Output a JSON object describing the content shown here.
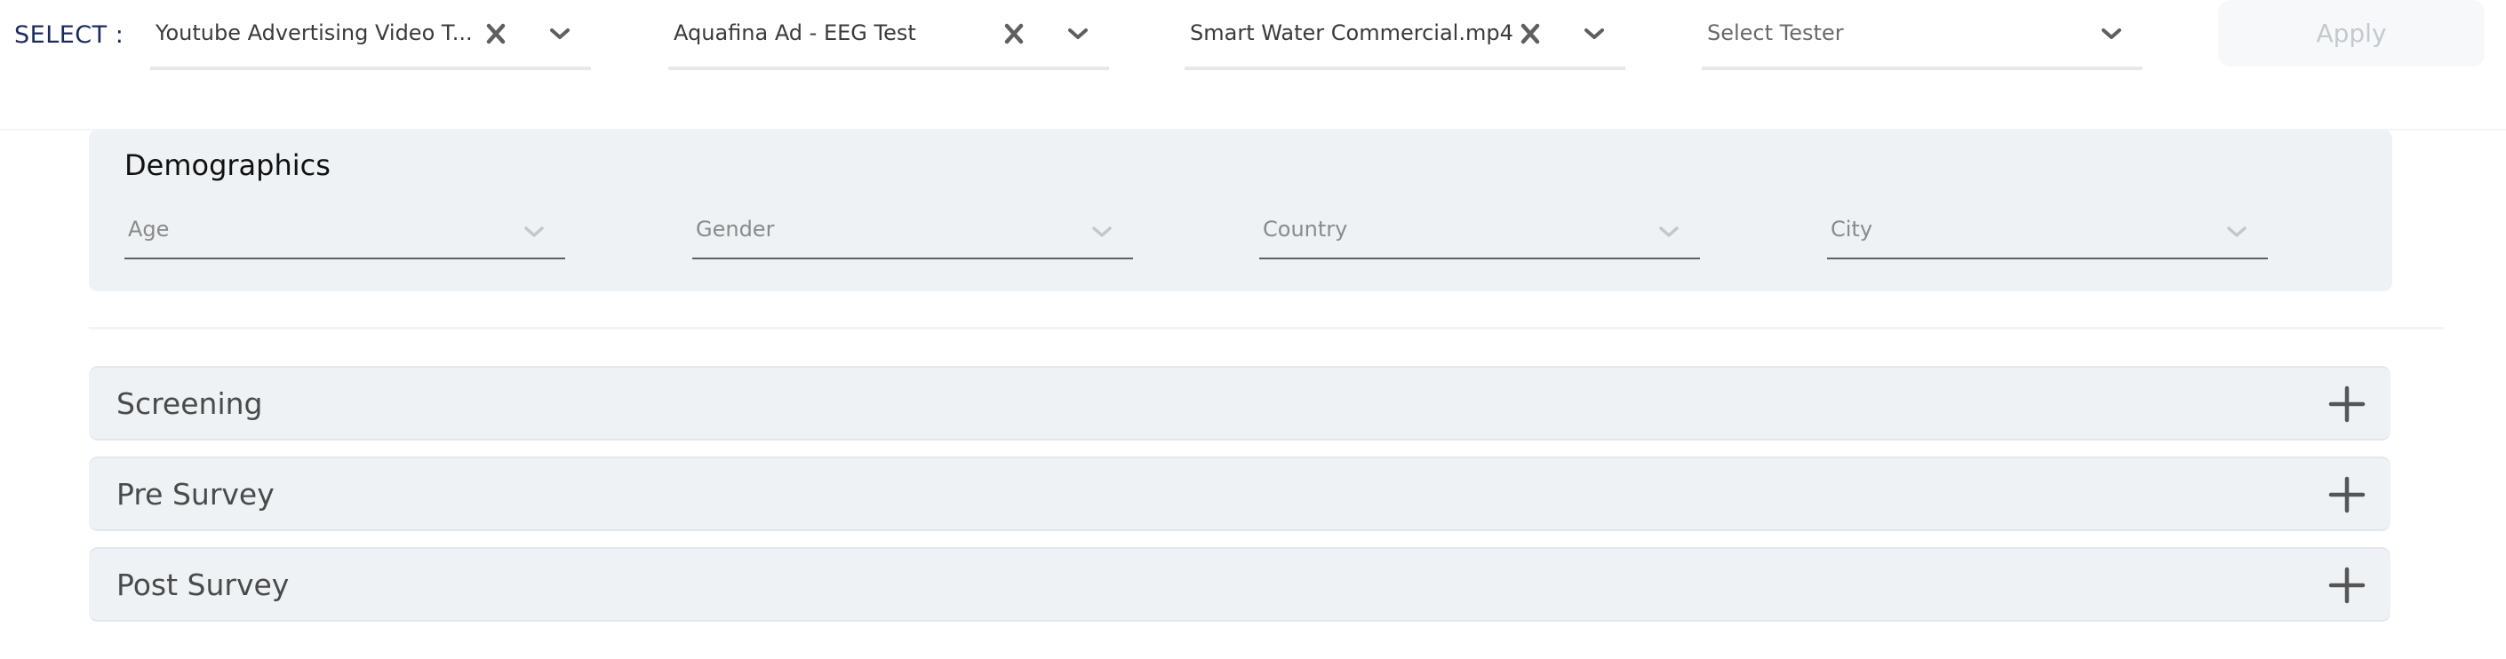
{
  "topbar": {
    "select_label": "SELECT :",
    "dropdowns": [
      {
        "value": "Youtube Advertising Video T...",
        "clearable": true,
        "placeholder": false
      },
      {
        "value": "Aquafina Ad - EEG Test",
        "clearable": true,
        "placeholder": false
      },
      {
        "value": "Smart Water Commercial.mp4",
        "clearable": true,
        "placeholder": false
      },
      {
        "value": "Select Tester",
        "clearable": false,
        "placeholder": true
      }
    ],
    "apply_label": "Apply",
    "icons": {
      "clear": "close-x-icon",
      "expand": "chevron-down-icon"
    }
  },
  "demographics": {
    "title": "Demographics",
    "fields": [
      {
        "label": "Age"
      },
      {
        "label": "Gender"
      },
      {
        "label": "Country"
      },
      {
        "label": "City"
      }
    ]
  },
  "accordions": [
    {
      "title": "Screening",
      "icon": "plus-icon"
    },
    {
      "title": "Pre Survey",
      "icon": "plus-icon"
    },
    {
      "title": "Post Survey",
      "icon": "plus-icon"
    }
  ],
  "colors": {
    "select_label": "#1c2b5e",
    "panel_bg": "#eef2f5",
    "apply_bg": "#f7f8fa",
    "apply_text": "#c4c8d0",
    "icon": "#5f5f5f"
  }
}
